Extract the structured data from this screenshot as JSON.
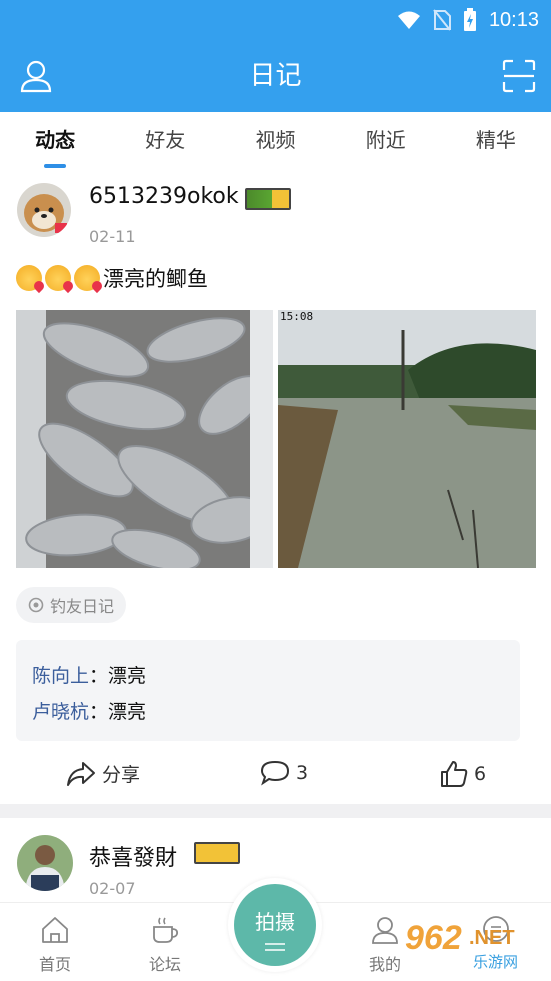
{
  "status_bar": {
    "time": "10:13"
  },
  "header": {
    "title": "日记"
  },
  "tabs": [
    {
      "label": "动态",
      "active": true
    },
    {
      "label": "好友",
      "active": false
    },
    {
      "label": "视频",
      "active": false
    },
    {
      "label": "附近",
      "active": false
    },
    {
      "label": "精华",
      "active": false
    }
  ],
  "post1": {
    "username": "6513239okok",
    "date": "02-11",
    "text": "漂亮的鲫鱼",
    "photo2_overlay": "15:08",
    "tag": "钓友日记",
    "comments": [
      {
        "author": "陈向上",
        "separator": "：",
        "text": "漂亮"
      },
      {
        "author": "卢晓杭",
        "separator": "：",
        "text": "漂亮"
      }
    ],
    "actions": {
      "share_label": "分享",
      "comment_count": "3",
      "like_count": "6"
    }
  },
  "post2": {
    "username": "恭喜發財",
    "date": "02-07"
  },
  "bottom_nav": {
    "home": "首页",
    "forum": "论坛",
    "capture": "拍摄",
    "mine": "我的"
  },
  "watermark": {
    "number": "962",
    "suffix": ".NET",
    "site": "乐游网"
  },
  "colors": {
    "primary": "#34a0ee",
    "fab": "#5db8a9",
    "comment_author": "#3b5e9c"
  }
}
